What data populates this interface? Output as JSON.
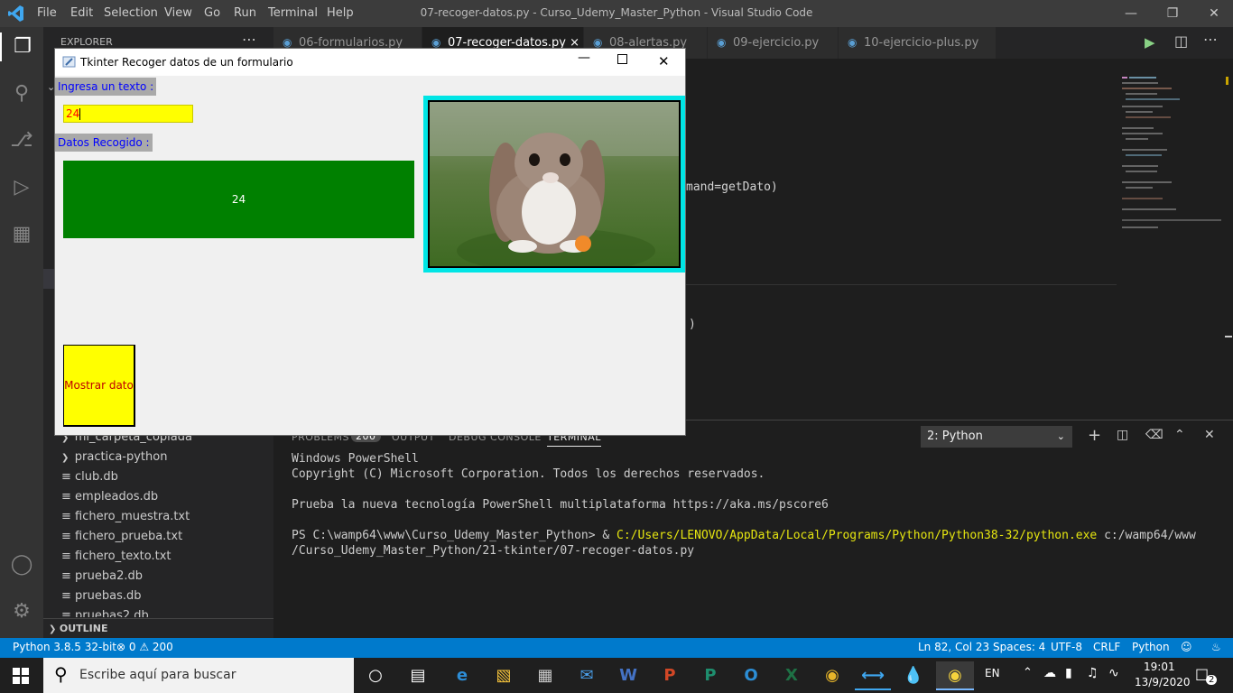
{
  "vscode": {
    "menu": [
      "File",
      "Edit",
      "Selection",
      "View",
      "Go",
      "Run",
      "Terminal",
      "Help"
    ],
    "window_title": "07-recoger-datos.py - Curso_Udemy_Master_Python - Visual Studio Code",
    "sidebar_title": "EXPLORER",
    "explorer_items": [
      "mi_carpeta_copiada",
      "practica-python",
      "club.db",
      "empleados.db",
      "fichero_muestra.txt",
      "fichero_prueba.txt",
      "fichero_texto.txt",
      "prueba2.db",
      "pruebas.db",
      "pruebas2.db"
    ],
    "outline_label": "OUTLINE",
    "tabs": [
      "06-formularios.py",
      "07-recoger-datos.py",
      "08-alertas.py",
      "09-ejercicio.py",
      "10-ejercicio-plus.py"
    ],
    "active_tab_close": "×",
    "code_fragment_1": "mand=getDato)",
    "code_fragment_2": ")",
    "panel_tabs": [
      "PROBLEMS",
      "200",
      "OUTPUT",
      "DEBUG CONSOLE",
      "TERMINAL"
    ],
    "terminal_select": "2: Python",
    "terminal_lines": [
      "Windows PowerShell",
      "Copyright (C) Microsoft Corporation. Todos los derechos reservados.",
      "",
      "Prueba la nueva tecnología PowerShell multiplataforma https://aka.ms/pscore6",
      ""
    ],
    "prompt_prefix": "PS C:\\wamp64\\www\\Curso_Udemy_Master_Python> & ",
    "prompt_exe": "C:/Users/LENOVO/AppData/Local/Programs/Python/Python38-32/python.exe",
    "prompt_arg": " c:/wamp64/www",
    "prompt_line2": "/Curso_Udemy_Master_Python/21-tkinter/07-recoger-datos.py"
  },
  "status": {
    "python": "Python 3.8.5 32-bit",
    "errors": "⊗ 0 ⚠ 200",
    "position": "Ln 82, Col 23",
    "spaces": "Spaces: 4",
    "encoding": "UTF-8",
    "eol": "CRLF",
    "language": "Python"
  },
  "taskbar": {
    "search_placeholder": "Escribe aquí para buscar",
    "lang": "EN",
    "time": "19:01",
    "date": "13/9/2020",
    "notif_count": "2"
  },
  "tkinter": {
    "title": "Tkinter Recoger datos de un formulario",
    "label_input": "Ingresa un texto :",
    "entry_value": "24",
    "label_result": "Datos Recogido :",
    "result_value": "24",
    "button_label": "Mostrar dato",
    "colors": {
      "label_bg": "#a9a9a9",
      "label_fg": "#0000ff",
      "entry_bg": "#ffff00",
      "entry_fg": "#ff0000",
      "result_bg": "#008000",
      "result_fg": "#ffffff",
      "button_bg": "#ffff00",
      "button_fg": "#c00000",
      "image_border": "#00e5e5"
    },
    "image_subject": "rabbit-photo"
  }
}
